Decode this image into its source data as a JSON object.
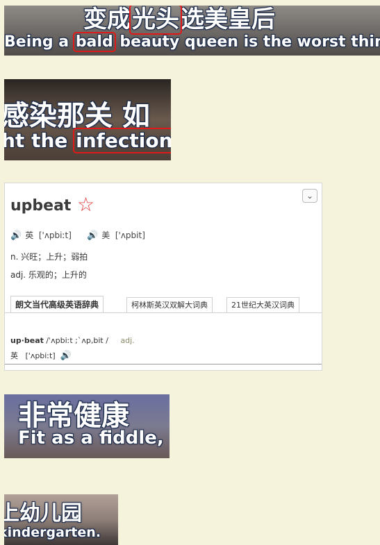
{
  "clips": [
    {
      "zh_pre": "变成",
      "zh_hl": "光头",
      "zh_post": "选美皇后",
      "en_pre": "Being a ",
      "en_hl": "bald",
      "en_post": " beauty queen is the worst thing"
    },
    {
      "zh": "感染那关  如",
      "en_pre": "ht the ",
      "en_hl": "infection",
      "en_post": ","
    },
    {
      "zh": "非常健康",
      "en": "Fit as a fiddle,"
    },
    {
      "zh": "上幼儿园",
      "en": "kindergarten."
    }
  ],
  "dictionary": {
    "word": "upbeat",
    "star_icon": "☆",
    "collapse_icon": "⌄",
    "speaker_icon": "🔊",
    "uk_label": "英",
    "uk_phonetic": "['ʌpbiːt]",
    "us_label": "美",
    "us_phonetic": "['ʌpbit]",
    "definitions": [
      "n. 兴旺；上升；弱拍",
      "adj. 乐观的；上升的"
    ],
    "tabs": [
      "朗文当代高级英语辞典",
      "柯林斯英汉双解大词典",
      "21世纪大英汉词典"
    ],
    "entry_headword": "up·beat",
    "entry_phonetic": "/ˈʌpbiːt ;ˋʌp,bit /",
    "entry_pos": "adj.",
    "entry_uk_label": "英",
    "entry_uk_phonetic": "['ʌpbiːt]"
  }
}
